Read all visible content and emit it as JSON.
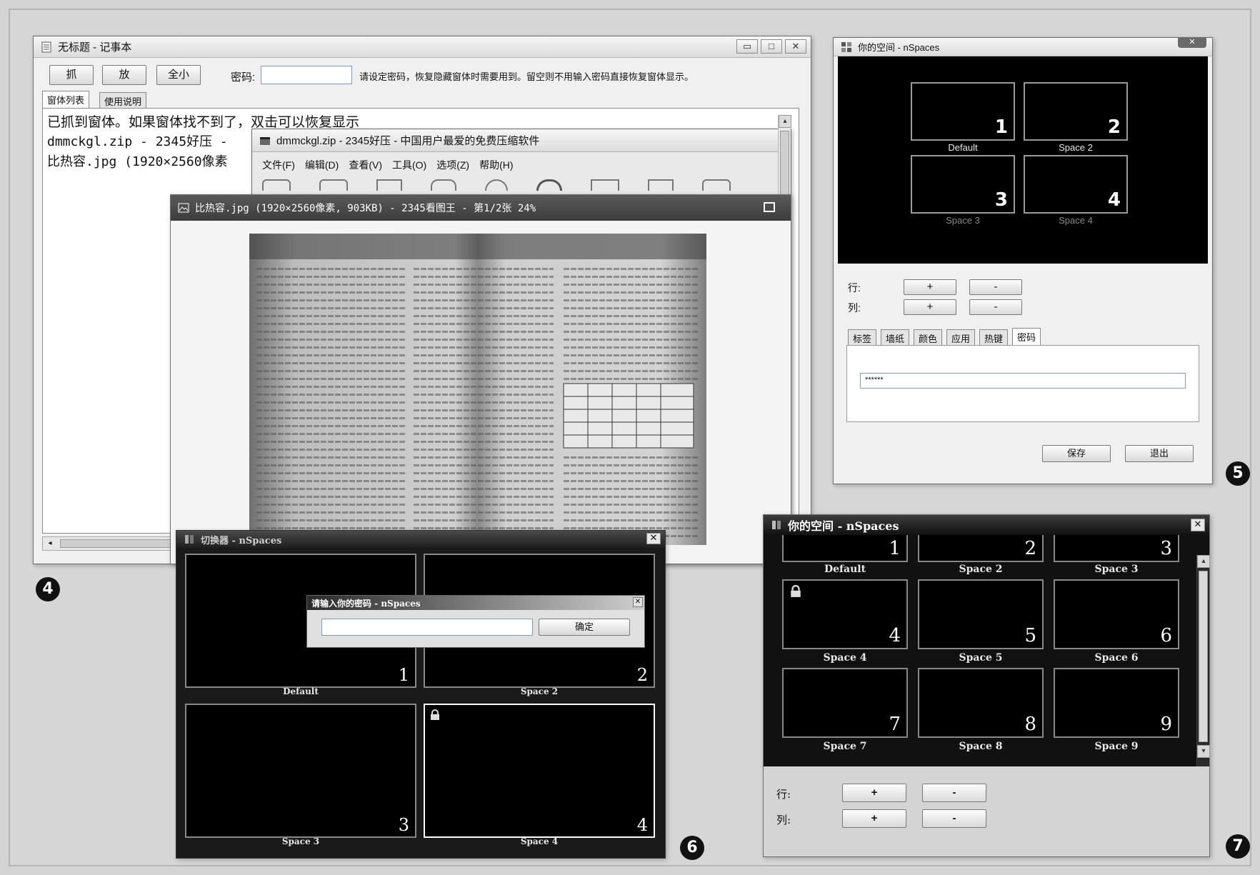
{
  "notepad": {
    "title": "无标题 - 记事本",
    "buttons": {
      "grab": "抓",
      "release": "放",
      "minimize_all": "全小"
    },
    "password_label": "密码:",
    "password_hint": "请设定密码，恢复隐藏窗体时需要用到。留空则不用输入密码直接恢复窗体显示。",
    "tabs": [
      "窗体列表",
      "使用说明"
    ],
    "lines": [
      "已抓到窗体。如果窗体找不到了，双击可以恢复显示",
      "dmmckgl.zip - 2345好压 -",
      "比热容.jpg (1920×2560像素"
    ]
  },
  "zip_window": {
    "title": "dmmckgl.zip - 2345好压 - 中国用户最爱的免费压缩软件",
    "menu": [
      "文件(F)",
      "编辑(D)",
      "查看(V)",
      "工具(O)",
      "选项(Z)",
      "帮助(H)"
    ]
  },
  "image_viewer": {
    "title": "比热容.jpg (1920×2560像素, 903KB) - 2345看图王 - 第1/2张 24%"
  },
  "nspaces5": {
    "title": "你的空间 - nSpaces",
    "tiles": [
      {
        "num": "1",
        "name": "Default"
      },
      {
        "num": "2",
        "name": "Space 2"
      },
      {
        "num": "3",
        "name": "Space 3"
      },
      {
        "num": "4",
        "name": "Space 4"
      }
    ],
    "row_label": "行:",
    "col_label": "列:",
    "plus": "+",
    "minus": "-",
    "tabs": [
      "标签",
      "墙纸",
      "颜色",
      "应用",
      "热键",
      "密码"
    ],
    "password_value": "******",
    "save": "保存",
    "exit": "退出"
  },
  "switcher6": {
    "title": "切换器 - nSpaces",
    "tiles": [
      {
        "num": "1",
        "name": "Default"
      },
      {
        "num": "2",
        "name": "Space 2"
      },
      {
        "num": "3",
        "name": "Space 3"
      },
      {
        "num": "4",
        "name": "Space 4"
      }
    ],
    "dialog_title": "请输入你的密码 - nSpaces",
    "dialog_ok": "确定"
  },
  "nspaces7": {
    "title": "你的空间 - nSpaces",
    "tiles": [
      {
        "num": "1",
        "name": "Default"
      },
      {
        "num": "2",
        "name": "Space 2"
      },
      {
        "num": "3",
        "name": "Space 3"
      },
      {
        "num": "4",
        "name": "Space 4"
      },
      {
        "num": "5",
        "name": "Space 5"
      },
      {
        "num": "6",
        "name": "Space 6"
      },
      {
        "num": "7",
        "name": "Space 7"
      },
      {
        "num": "8",
        "name": "Space 8"
      },
      {
        "num": "9",
        "name": "Space 9"
      }
    ],
    "row_label": "行:",
    "col_label": "列:",
    "plus": "+",
    "minus": "-"
  },
  "badges": {
    "b4": "4",
    "b5": "5",
    "b6": "6",
    "b7": "7"
  },
  "icons": {
    "close": "close-icon",
    "lock": "lock-icon",
    "maximize": "maximize-icon",
    "minimize": "minimize-icon"
  }
}
